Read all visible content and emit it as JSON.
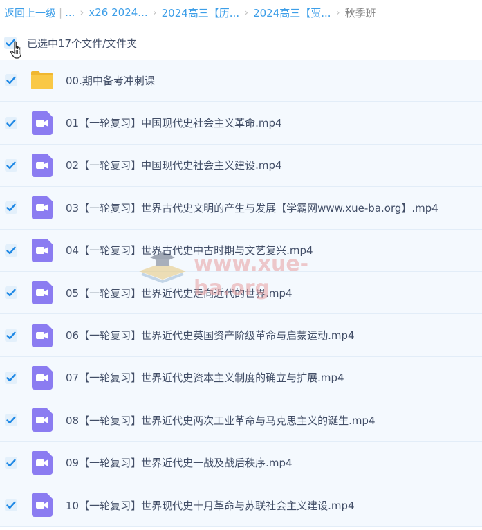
{
  "breadcrumb": {
    "back": "返回上一级",
    "ellipsis": "...",
    "items": [
      "x26 2024...",
      "2024高三【历...",
      "2024高三【贾..."
    ],
    "current": "秋季班"
  },
  "selection": {
    "text": "已选中17个文件/文件夹"
  },
  "files": [
    {
      "name": "00.期中备考冲刺课",
      "type": "folder"
    },
    {
      "name": "01【一轮复习】中国现代史社会主义革命.mp4",
      "type": "video"
    },
    {
      "name": "02【一轮复习】中国现代史社会主义建设.mp4",
      "type": "video"
    },
    {
      "name": "03【一轮复习】世界古代史文明的产生与发展【学霸网www.xue-ba.org】.mp4",
      "type": "video"
    },
    {
      "name": "04【一轮复习】世界古代史中古时期与文艺复兴.mp4",
      "type": "video"
    },
    {
      "name": "05【一轮复习】世界近代史走向近代的世界.mp4",
      "type": "video"
    },
    {
      "name": "06【一轮复习】世界近代史英国资产阶级革命与启蒙运动.mp4",
      "type": "video"
    },
    {
      "name": "07【一轮复习】世界近代史资本主义制度的确立与扩展.mp4",
      "type": "video"
    },
    {
      "name": "08【一轮复习】世界近代史两次工业革命与马克思主义的诞生.mp4",
      "type": "video"
    },
    {
      "name": "09【一轮复习】世界近代史一战及战后秩序.mp4",
      "type": "video"
    },
    {
      "name": "10【一轮复习】世界现代史十月革命与苏联社会主义建设.mp4",
      "type": "video"
    }
  ],
  "watermark": {
    "text": "www.xue-ba.org"
  },
  "colors": {
    "accent": "#3c9ee8",
    "video": "#8b7cf1",
    "folder": "#f9c846",
    "rowBg": "#f4f9fe"
  }
}
